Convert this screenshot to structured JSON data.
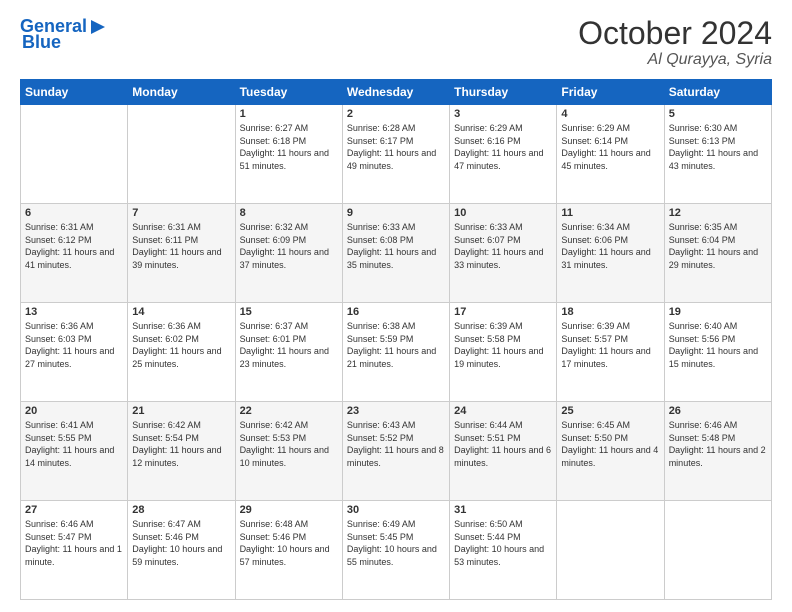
{
  "header": {
    "logo_line1": "General",
    "logo_line2": "Blue",
    "month": "October 2024",
    "location": "Al Qurayya, Syria"
  },
  "weekdays": [
    "Sunday",
    "Monday",
    "Tuesday",
    "Wednesday",
    "Thursday",
    "Friday",
    "Saturday"
  ],
  "weeks": [
    [
      {
        "day": "",
        "sunrise": "",
        "sunset": "",
        "daylight": ""
      },
      {
        "day": "",
        "sunrise": "",
        "sunset": "",
        "daylight": ""
      },
      {
        "day": "1",
        "sunrise": "Sunrise: 6:27 AM",
        "sunset": "Sunset: 6:18 PM",
        "daylight": "Daylight: 11 hours and 51 minutes."
      },
      {
        "day": "2",
        "sunrise": "Sunrise: 6:28 AM",
        "sunset": "Sunset: 6:17 PM",
        "daylight": "Daylight: 11 hours and 49 minutes."
      },
      {
        "day": "3",
        "sunrise": "Sunrise: 6:29 AM",
        "sunset": "Sunset: 6:16 PM",
        "daylight": "Daylight: 11 hours and 47 minutes."
      },
      {
        "day": "4",
        "sunrise": "Sunrise: 6:29 AM",
        "sunset": "Sunset: 6:14 PM",
        "daylight": "Daylight: 11 hours and 45 minutes."
      },
      {
        "day": "5",
        "sunrise": "Sunrise: 6:30 AM",
        "sunset": "Sunset: 6:13 PM",
        "daylight": "Daylight: 11 hours and 43 minutes."
      }
    ],
    [
      {
        "day": "6",
        "sunrise": "Sunrise: 6:31 AM",
        "sunset": "Sunset: 6:12 PM",
        "daylight": "Daylight: 11 hours and 41 minutes."
      },
      {
        "day": "7",
        "sunrise": "Sunrise: 6:31 AM",
        "sunset": "Sunset: 6:11 PM",
        "daylight": "Daylight: 11 hours and 39 minutes."
      },
      {
        "day": "8",
        "sunrise": "Sunrise: 6:32 AM",
        "sunset": "Sunset: 6:09 PM",
        "daylight": "Daylight: 11 hours and 37 minutes."
      },
      {
        "day": "9",
        "sunrise": "Sunrise: 6:33 AM",
        "sunset": "Sunset: 6:08 PM",
        "daylight": "Daylight: 11 hours and 35 minutes."
      },
      {
        "day": "10",
        "sunrise": "Sunrise: 6:33 AM",
        "sunset": "Sunset: 6:07 PM",
        "daylight": "Daylight: 11 hours and 33 minutes."
      },
      {
        "day": "11",
        "sunrise": "Sunrise: 6:34 AM",
        "sunset": "Sunset: 6:06 PM",
        "daylight": "Daylight: 11 hours and 31 minutes."
      },
      {
        "day": "12",
        "sunrise": "Sunrise: 6:35 AM",
        "sunset": "Sunset: 6:04 PM",
        "daylight": "Daylight: 11 hours and 29 minutes."
      }
    ],
    [
      {
        "day": "13",
        "sunrise": "Sunrise: 6:36 AM",
        "sunset": "Sunset: 6:03 PM",
        "daylight": "Daylight: 11 hours and 27 minutes."
      },
      {
        "day": "14",
        "sunrise": "Sunrise: 6:36 AM",
        "sunset": "Sunset: 6:02 PM",
        "daylight": "Daylight: 11 hours and 25 minutes."
      },
      {
        "day": "15",
        "sunrise": "Sunrise: 6:37 AM",
        "sunset": "Sunset: 6:01 PM",
        "daylight": "Daylight: 11 hours and 23 minutes."
      },
      {
        "day": "16",
        "sunrise": "Sunrise: 6:38 AM",
        "sunset": "Sunset: 5:59 PM",
        "daylight": "Daylight: 11 hours and 21 minutes."
      },
      {
        "day": "17",
        "sunrise": "Sunrise: 6:39 AM",
        "sunset": "Sunset: 5:58 PM",
        "daylight": "Daylight: 11 hours and 19 minutes."
      },
      {
        "day": "18",
        "sunrise": "Sunrise: 6:39 AM",
        "sunset": "Sunset: 5:57 PM",
        "daylight": "Daylight: 11 hours and 17 minutes."
      },
      {
        "day": "19",
        "sunrise": "Sunrise: 6:40 AM",
        "sunset": "Sunset: 5:56 PM",
        "daylight": "Daylight: 11 hours and 15 minutes."
      }
    ],
    [
      {
        "day": "20",
        "sunrise": "Sunrise: 6:41 AM",
        "sunset": "Sunset: 5:55 PM",
        "daylight": "Daylight: 11 hours and 14 minutes."
      },
      {
        "day": "21",
        "sunrise": "Sunrise: 6:42 AM",
        "sunset": "Sunset: 5:54 PM",
        "daylight": "Daylight: 11 hours and 12 minutes."
      },
      {
        "day": "22",
        "sunrise": "Sunrise: 6:42 AM",
        "sunset": "Sunset: 5:53 PM",
        "daylight": "Daylight: 11 hours and 10 minutes."
      },
      {
        "day": "23",
        "sunrise": "Sunrise: 6:43 AM",
        "sunset": "Sunset: 5:52 PM",
        "daylight": "Daylight: 11 hours and 8 minutes."
      },
      {
        "day": "24",
        "sunrise": "Sunrise: 6:44 AM",
        "sunset": "Sunset: 5:51 PM",
        "daylight": "Daylight: 11 hours and 6 minutes."
      },
      {
        "day": "25",
        "sunrise": "Sunrise: 6:45 AM",
        "sunset": "Sunset: 5:50 PM",
        "daylight": "Daylight: 11 hours and 4 minutes."
      },
      {
        "day": "26",
        "sunrise": "Sunrise: 6:46 AM",
        "sunset": "Sunset: 5:48 PM",
        "daylight": "Daylight: 11 hours and 2 minutes."
      }
    ],
    [
      {
        "day": "27",
        "sunrise": "Sunrise: 6:46 AM",
        "sunset": "Sunset: 5:47 PM",
        "daylight": "Daylight: 11 hours and 1 minute."
      },
      {
        "day": "28",
        "sunrise": "Sunrise: 6:47 AM",
        "sunset": "Sunset: 5:46 PM",
        "daylight": "Daylight: 10 hours and 59 minutes."
      },
      {
        "day": "29",
        "sunrise": "Sunrise: 6:48 AM",
        "sunset": "Sunset: 5:46 PM",
        "daylight": "Daylight: 10 hours and 57 minutes."
      },
      {
        "day": "30",
        "sunrise": "Sunrise: 6:49 AM",
        "sunset": "Sunset: 5:45 PM",
        "daylight": "Daylight: 10 hours and 55 minutes."
      },
      {
        "day": "31",
        "sunrise": "Sunrise: 6:50 AM",
        "sunset": "Sunset: 5:44 PM",
        "daylight": "Daylight: 10 hours and 53 minutes."
      },
      {
        "day": "",
        "sunrise": "",
        "sunset": "",
        "daylight": ""
      },
      {
        "day": "",
        "sunrise": "",
        "sunset": "",
        "daylight": ""
      }
    ]
  ]
}
